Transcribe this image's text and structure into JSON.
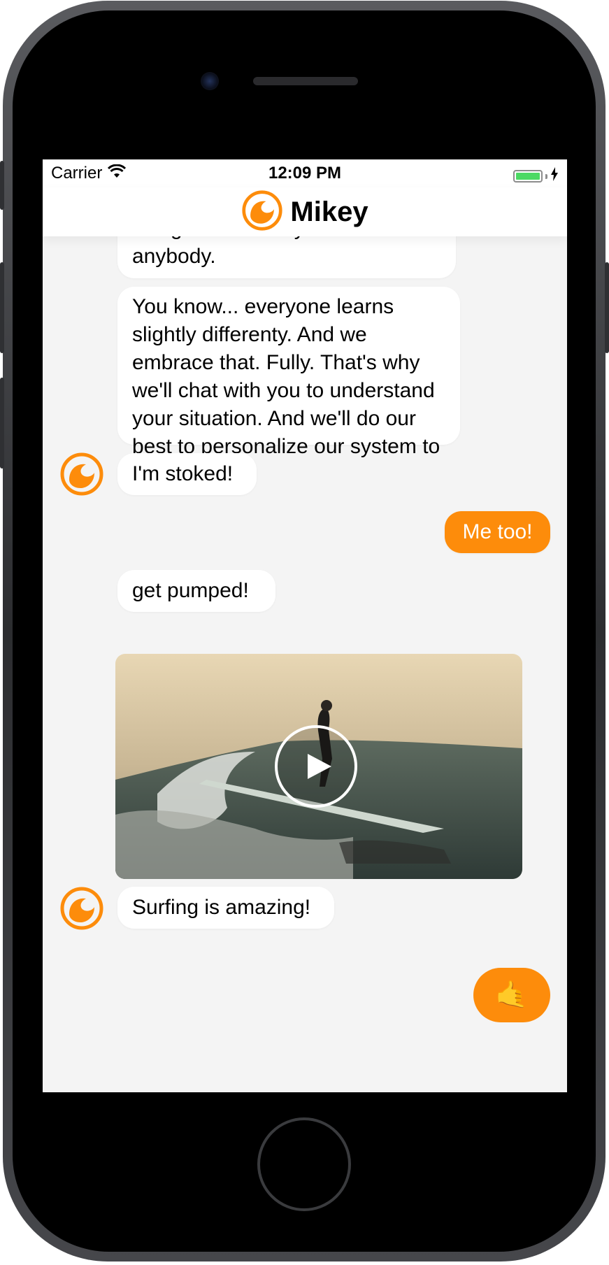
{
  "status_bar": {
    "carrier": "Carrier",
    "time": "12:09 PM",
    "battery_level": 1.0,
    "wifi_icon": "wifi-icon",
    "charging_icon": "bolt-icon"
  },
  "nav": {
    "title": "Mikey",
    "logo_icon": "wave-logo-icon"
  },
  "messages": {
    "m1_line1": "using is extremelly useful for",
    "m1_line2": "anybody.",
    "m2": "You know... everyone learns slightly differenty. And we embrace that. Fully. That's why we'll chat with you to understand your situation. And we'll do our best to personalize our system to your needs.",
    "m3": "I'm stoked!",
    "m4": "Me too!",
    "m5": "get pumped!",
    "m6": "Surfing is amazing!"
  },
  "video": {
    "play_icon": "play-icon",
    "subject": "surfer on wave"
  },
  "fab": {
    "emoji": "🤙"
  },
  "colors": {
    "accent": "#fd8c0b",
    "chat_background": "#f4f4f4",
    "bubble": "#ffffff",
    "battery": "#4cd964"
  }
}
